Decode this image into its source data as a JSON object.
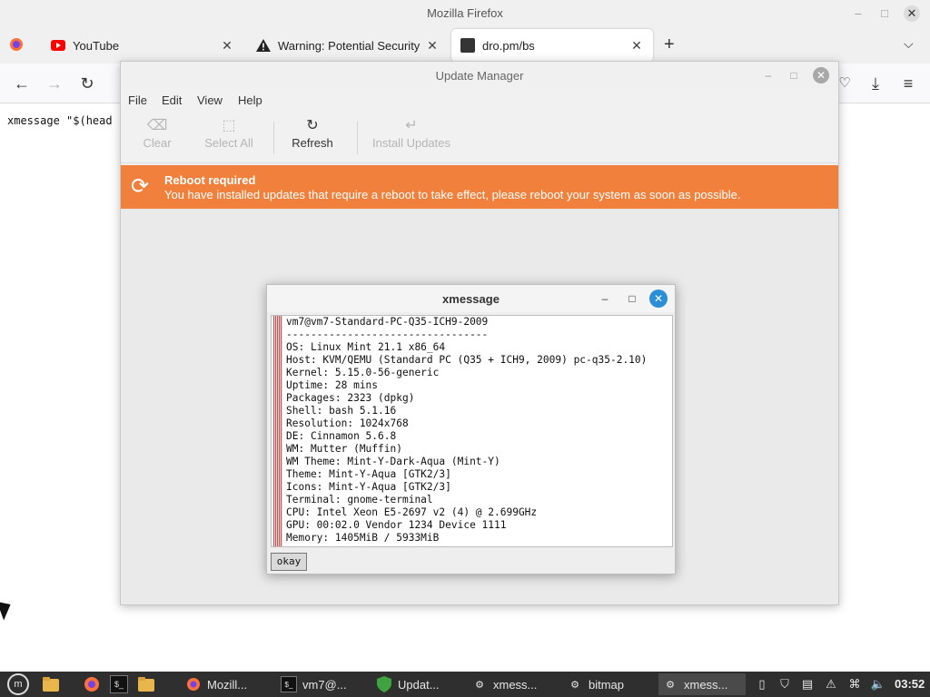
{
  "firefox": {
    "window_title": "Mozilla Firefox",
    "tabs": [
      {
        "label": "YouTube",
        "icon": "youtube-icon"
      },
      {
        "label": "Warning: Potential Security",
        "icon": "warning-icon"
      },
      {
        "label": "dro.pm/bs",
        "icon": "page-thumbnail-icon"
      }
    ],
    "new_tab": "+",
    "page_text": "xmessage \"$(head"
  },
  "update_manager": {
    "title": "Update Manager",
    "menu": [
      "File",
      "Edit",
      "View",
      "Help"
    ],
    "toolbar": {
      "clear": "Clear",
      "select_all": "Select All",
      "refresh": "Refresh",
      "install_updates": "Install Updates"
    },
    "banner": {
      "title": "Reboot required",
      "message": "You have installed updates that require a reboot to take effect, please reboot your system as soon as possible.",
      "color": "#f0803b"
    }
  },
  "xmessage": {
    "title": "xmessage",
    "lines": [
      "vm7@vm7-Standard-PC-Q35-ICH9-2009",
      "---------------------------------",
      "OS: Linux Mint 21.1 x86_64",
      "Host: KVM/QEMU (Standard PC (Q35 + ICH9, 2009) pc-q35-2.10)",
      "Kernel: 5.15.0-56-generic",
      "Uptime: 28 mins",
      "Packages: 2323 (dpkg)",
      "Shell: bash 5.1.16",
      "Resolution: 1024x768",
      "DE: Cinnamon 5.6.8",
      "WM: Mutter (Muffin)",
      "WM Theme: Mint-Y-Dark-Aqua (Mint-Y)",
      "Theme: Mint-Y-Aqua [GTK2/3]",
      "Icons: Mint-Y-Aqua [GTK2/3]",
      "Terminal: gnome-terminal",
      "CPU: Intel Xeon E5-2697 v2 (4) @ 2.699GHz",
      "GPU: 00:02.0 Vendor 1234 Device 1111",
      "Memory: 1405MiB / 5933MiB"
    ],
    "okay_button": "okay"
  },
  "taskbar": {
    "windows": [
      {
        "label": "Mozill...",
        "icon": "firefox-icon"
      },
      {
        "label": "vm7@...",
        "icon": "terminal-icon"
      },
      {
        "label": "Updat...",
        "icon": "shield-icon"
      },
      {
        "label": "xmess...",
        "icon": "gear-icon"
      },
      {
        "label": "bitmap",
        "icon": "gear-icon"
      },
      {
        "label": "xmess...",
        "icon": "gear-icon"
      }
    ],
    "clock": "03:52"
  }
}
